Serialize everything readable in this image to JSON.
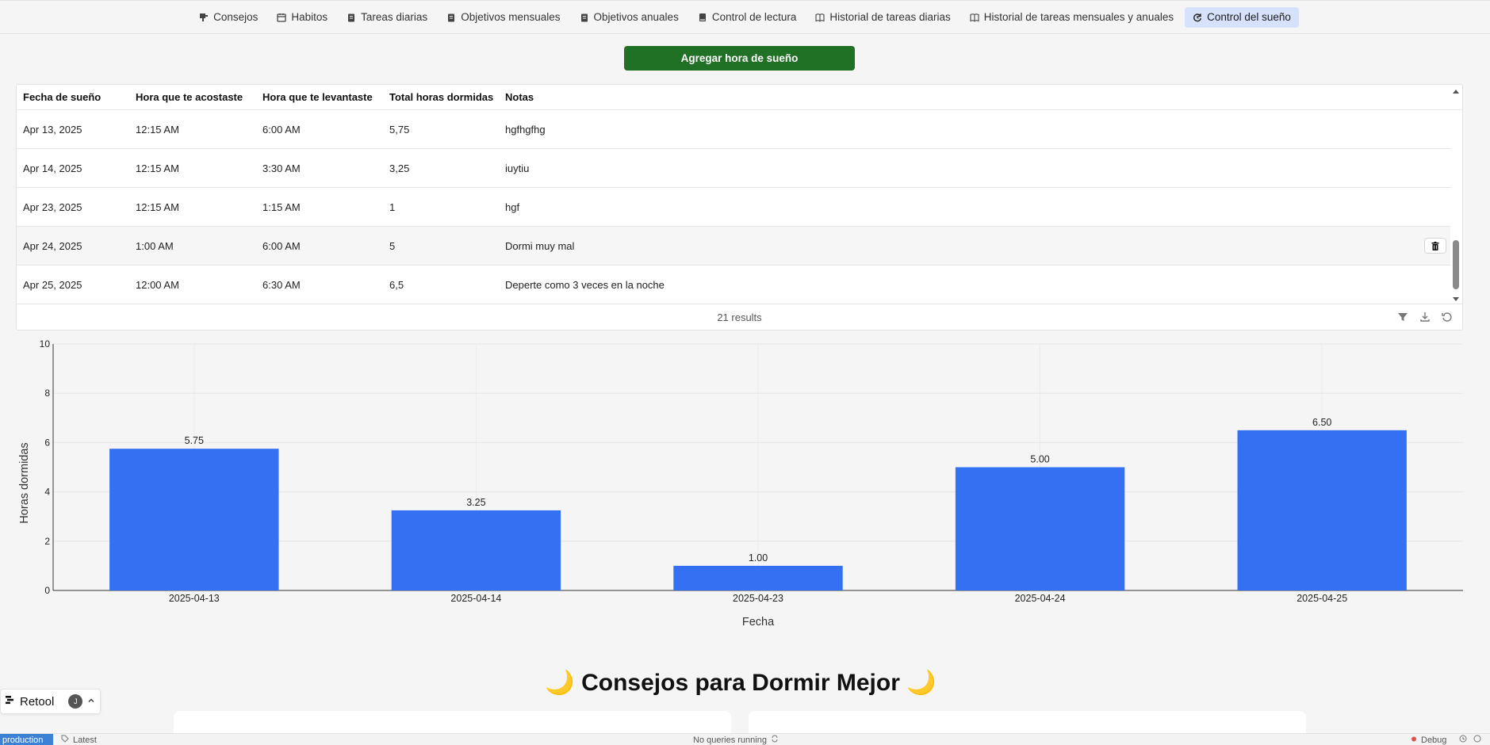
{
  "nav": {
    "tabs": [
      {
        "label": "Consejos",
        "icon": "lightbulb-icon"
      },
      {
        "label": "Habitos",
        "icon": "calendar-icon"
      },
      {
        "label": "Tareas diarias",
        "icon": "clipboard-icon"
      },
      {
        "label": "Objetivos mensuales",
        "icon": "clipboard-icon"
      },
      {
        "label": "Objetivos anuales",
        "icon": "clipboard-icon"
      },
      {
        "label": "Control de lectura",
        "icon": "book-icon"
      },
      {
        "label": "Historial de tareas diarias",
        "icon": "open-book-icon"
      },
      {
        "label": "Historial de tareas mensuales y anuales",
        "icon": "open-book-icon"
      },
      {
        "label": "Control del sueño",
        "icon": "refresh-clock-icon",
        "active": true
      }
    ]
  },
  "actions": {
    "add_sleep_label": "Agregar hora de sueño"
  },
  "table": {
    "columns": [
      "Fecha de sueño",
      "Hora que te acostaste",
      "Hora que te levantaste",
      "Total horas dormidas",
      "Notas"
    ],
    "rows": [
      [
        "Apr 13, 2025",
        "12:15 AM",
        "6:00 AM",
        "5,75",
        "hgfhgfhg"
      ],
      [
        "Apr 14, 2025",
        "12:15 AM",
        "3:30 AM",
        "3,25",
        "iuytiu"
      ],
      [
        "Apr 23, 2025",
        "12:15 AM",
        "1:15 AM",
        "1",
        "hgf"
      ],
      [
        "Apr 24, 2025",
        "1:00 AM",
        "6:00 AM",
        "5",
        "Dormi muy mal"
      ],
      [
        "Apr 25, 2025",
        "12:00 AM",
        "6:30 AM",
        "6,5",
        "Deperte como 3 veces en la noche"
      ]
    ],
    "results_label": "21 results"
  },
  "chart_data": {
    "type": "bar",
    "categories": [
      "2025-04-13",
      "2025-04-14",
      "2025-04-23",
      "2025-04-24",
      "2025-04-25"
    ],
    "values": [
      5.75,
      3.25,
      1.0,
      5.0,
      6.5
    ],
    "value_labels": [
      "5.75",
      "3.25",
      "1.00",
      "5.00",
      "6.50"
    ],
    "xlabel": "Fecha",
    "ylabel": "Horas dormidas",
    "ylim": [
      0,
      10
    ],
    "yticks": [
      0,
      2,
      4,
      6,
      8,
      10
    ],
    "grid": true,
    "bar_color": "#3371f2"
  },
  "tips": {
    "title": "🌙 Consejos para Dormir Mejor 🌙"
  },
  "retool": {
    "name": "Retool",
    "avatar_initial": "J"
  },
  "status": {
    "env": "production",
    "version": "Latest",
    "queries": "No queries running",
    "debug": "Debug"
  },
  "colors": {
    "accent": "#207025",
    "bar": "#3371f2",
    "active_tab": "#d6e2fb"
  }
}
